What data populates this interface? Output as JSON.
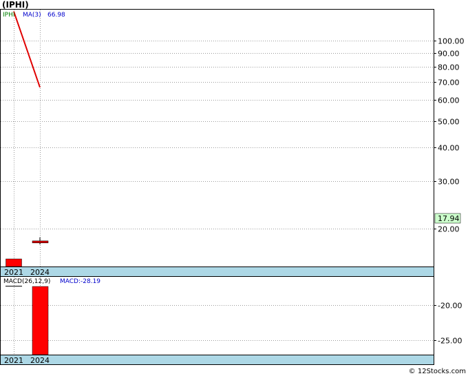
{
  "title": "(IPHI)",
  "credit": "© 12Stocks.com",
  "colors": {
    "price_line": "#e00000",
    "candle": "#cc0000",
    "volume_bar": "#ff0000",
    "macd_bar": "#ff0000",
    "date_band": "#add8e6",
    "last_price_bg": "#ccffcc",
    "legend_ticker": "#008000",
    "legend_ma": "#0000cc"
  },
  "chart_data": [
    {
      "type": "line",
      "name": "price-panel",
      "scale": "log",
      "ylim": [
        14.5,
        130
      ],
      "y_ticks": [
        "100.00",
        "90.00",
        "80.00",
        "70.00",
        "60.00",
        "50.00",
        "40.00",
        "30.00",
        "20.00"
      ],
      "y_tick_values": [
        100,
        90,
        80,
        70,
        60,
        50,
        40,
        30,
        20
      ],
      "x_tick_labels": [
        "2021",
        "2024"
      ],
      "legend": {
        "ticker": "IPHI",
        "ma_label": "MA(3)",
        "ma_value": "66.98"
      },
      "last_price": "17.94",
      "ma_line": {
        "x": [
          "2021",
          "2024"
        ],
        "y": [
          128,
          66.98
        ]
      },
      "candle": {
        "x": "2024",
        "open": 17.94,
        "close": 17.94,
        "high": 18.6,
        "low": 17.5
      },
      "volume": {
        "x": [
          "2021"
        ],
        "values": [
          1
        ],
        "relative_heights": [
          0.55
        ]
      }
    },
    {
      "type": "bar",
      "name": "macd-panel",
      "ylim": [
        -27,
        -16
      ],
      "y_ticks": [
        "-20.00",
        "-25.00"
      ],
      "y_tick_values": [
        -20,
        -25
      ],
      "x_tick_labels": [
        "2021",
        "2024"
      ],
      "legend": {
        "label": "MACD(26,12,9)",
        "value_label": "MACD:-28.19"
      },
      "bars": [
        {
          "x": "2024",
          "value": -28.19
        }
      ]
    }
  ]
}
